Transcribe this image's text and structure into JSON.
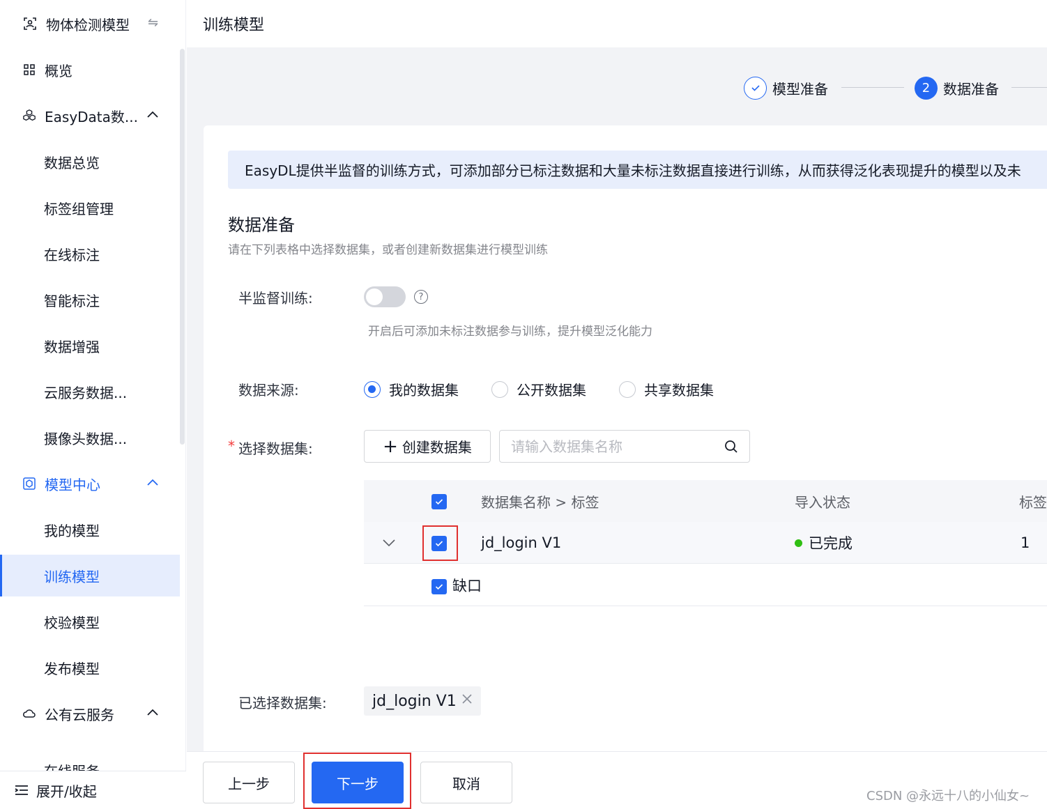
{
  "sidebar": {
    "project_title": "物体检测模型",
    "items": [
      {
        "label": "概览"
      },
      {
        "label": "EasyData数..."
      },
      {
        "label": "数据总览"
      },
      {
        "label": "标签组管理"
      },
      {
        "label": "在线标注"
      },
      {
        "label": "智能标注"
      },
      {
        "label": "数据增强"
      },
      {
        "label": "云服务数据..."
      },
      {
        "label": "摄像头数据..."
      },
      {
        "label": "模型中心"
      },
      {
        "label": "我的模型"
      },
      {
        "label": "训练模型"
      },
      {
        "label": "校验模型"
      },
      {
        "label": "发布模型"
      },
      {
        "label": "公有云服务"
      },
      {
        "label": "在线服务"
      }
    ],
    "footer_label": "展开/收起"
  },
  "page_title": "训练模型",
  "steps": [
    {
      "number": "",
      "label": "模型准备",
      "state": "done"
    },
    {
      "number": "2",
      "label": "数据准备",
      "state": "current"
    }
  ],
  "notice": "EasyDL提供半监督的训练方式，可添加部分已标注数据和大量未标注数据直接进行训练，从而获得泛化表现提升的模型以及未",
  "section": {
    "title": "数据准备",
    "description": "请在下列表格中选择数据集，或者创建新数据集进行模型训练"
  },
  "semi_supervised": {
    "label": "半监督训练:",
    "enabled": false,
    "help": "?",
    "description": "开启后可添加未标注数据参与训练，提升模型泛化能力"
  },
  "data_source": {
    "label": "数据来源:",
    "options": [
      "我的数据集",
      "公开数据集",
      "共享数据集"
    ],
    "selected": "我的数据集"
  },
  "dataset_select": {
    "required_mark": "*",
    "label": "选择数据集:",
    "create_button": "创建数据集",
    "search_placeholder": "请输入数据集名称",
    "search_value": ""
  },
  "table": {
    "headers": [
      "数据集名称 > 标签",
      "导入状态",
      "标签"
    ],
    "rows": [
      {
        "name": "jd_login V1",
        "status": "已完成",
        "labels": "1",
        "checked": true,
        "sub_items": [
          {
            "label": "缺口",
            "checked": true
          }
        ]
      }
    ]
  },
  "selected": {
    "label": "已选择数据集:",
    "tag": "jd_login V1"
  },
  "footer": {
    "prev": "上一步",
    "next": "下一步",
    "cancel": "取消"
  },
  "watermark": "CSDN @永远十八的小仙女~",
  "colors": {
    "accent": "#2468f2",
    "success": "#30bf13",
    "highlight": "#e0302f"
  }
}
